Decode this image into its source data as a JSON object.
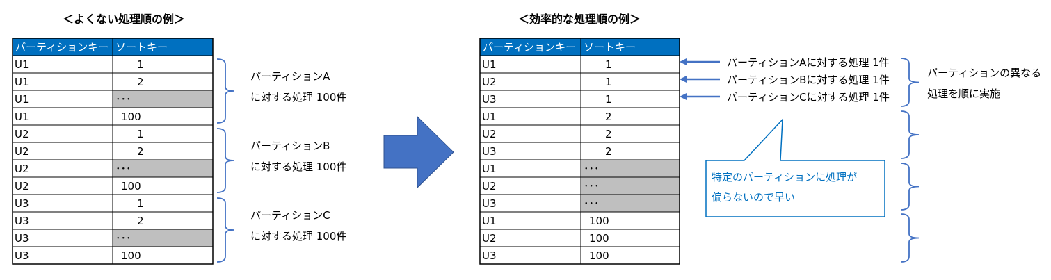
{
  "colors": {
    "header": "#0070c0",
    "ellipsis_fill": "#bfbfbf",
    "bracket": "#4472c4",
    "arrow": "#4472c4",
    "callout": "#0070c0"
  },
  "left": {
    "title": "＜よくない処理順の例＞",
    "headers": [
      "パーティションキー",
      "ソートキー"
    ],
    "rows": [
      [
        "U1",
        "1"
      ],
      [
        "U1",
        "2"
      ],
      [
        "U1",
        "･･･"
      ],
      [
        "U1",
        "100"
      ],
      [
        "U2",
        "1"
      ],
      [
        "U2",
        "2"
      ],
      [
        "U2",
        "･･･"
      ],
      [
        "U2",
        "100"
      ],
      [
        "U3",
        "1"
      ],
      [
        "U3",
        "2"
      ],
      [
        "U3",
        "･･･"
      ],
      [
        "U3",
        "100"
      ]
    ],
    "groups": [
      {
        "line1": "パーティションA",
        "line2": "に対する処理 100件"
      },
      {
        "line1": "パーティションB",
        "line2": "に対する処理 100件"
      },
      {
        "line1": "パーティションC",
        "line2": "に対する処理 100件"
      }
    ]
  },
  "right": {
    "title": "＜効率的な処理順の例＞",
    "headers": [
      "パーティションキー",
      "ソートキー"
    ],
    "rows": [
      [
        "U1",
        "1"
      ],
      [
        "U2",
        "1"
      ],
      [
        "U3",
        "1"
      ],
      [
        "U1",
        "2"
      ],
      [
        "U2",
        "2"
      ],
      [
        "U3",
        "2"
      ],
      [
        "U1",
        "･･･"
      ],
      [
        "U2",
        "･･･"
      ],
      [
        "U3",
        "･･･"
      ],
      [
        "U1",
        "100"
      ],
      [
        "U2",
        "100"
      ],
      [
        "U3",
        "100"
      ]
    ],
    "arrow_labels": [
      "パーティションAに対する処理 1件",
      "パーティションBに対する処理 1件",
      "パーティションCに対する処理 1件"
    ],
    "bracket_label": {
      "line1": "パーティションの異なる",
      "line2": "処理を順に実施"
    },
    "callout": {
      "line1": "特定のパーティションに処理が",
      "line2": "偏らないので早い"
    }
  }
}
